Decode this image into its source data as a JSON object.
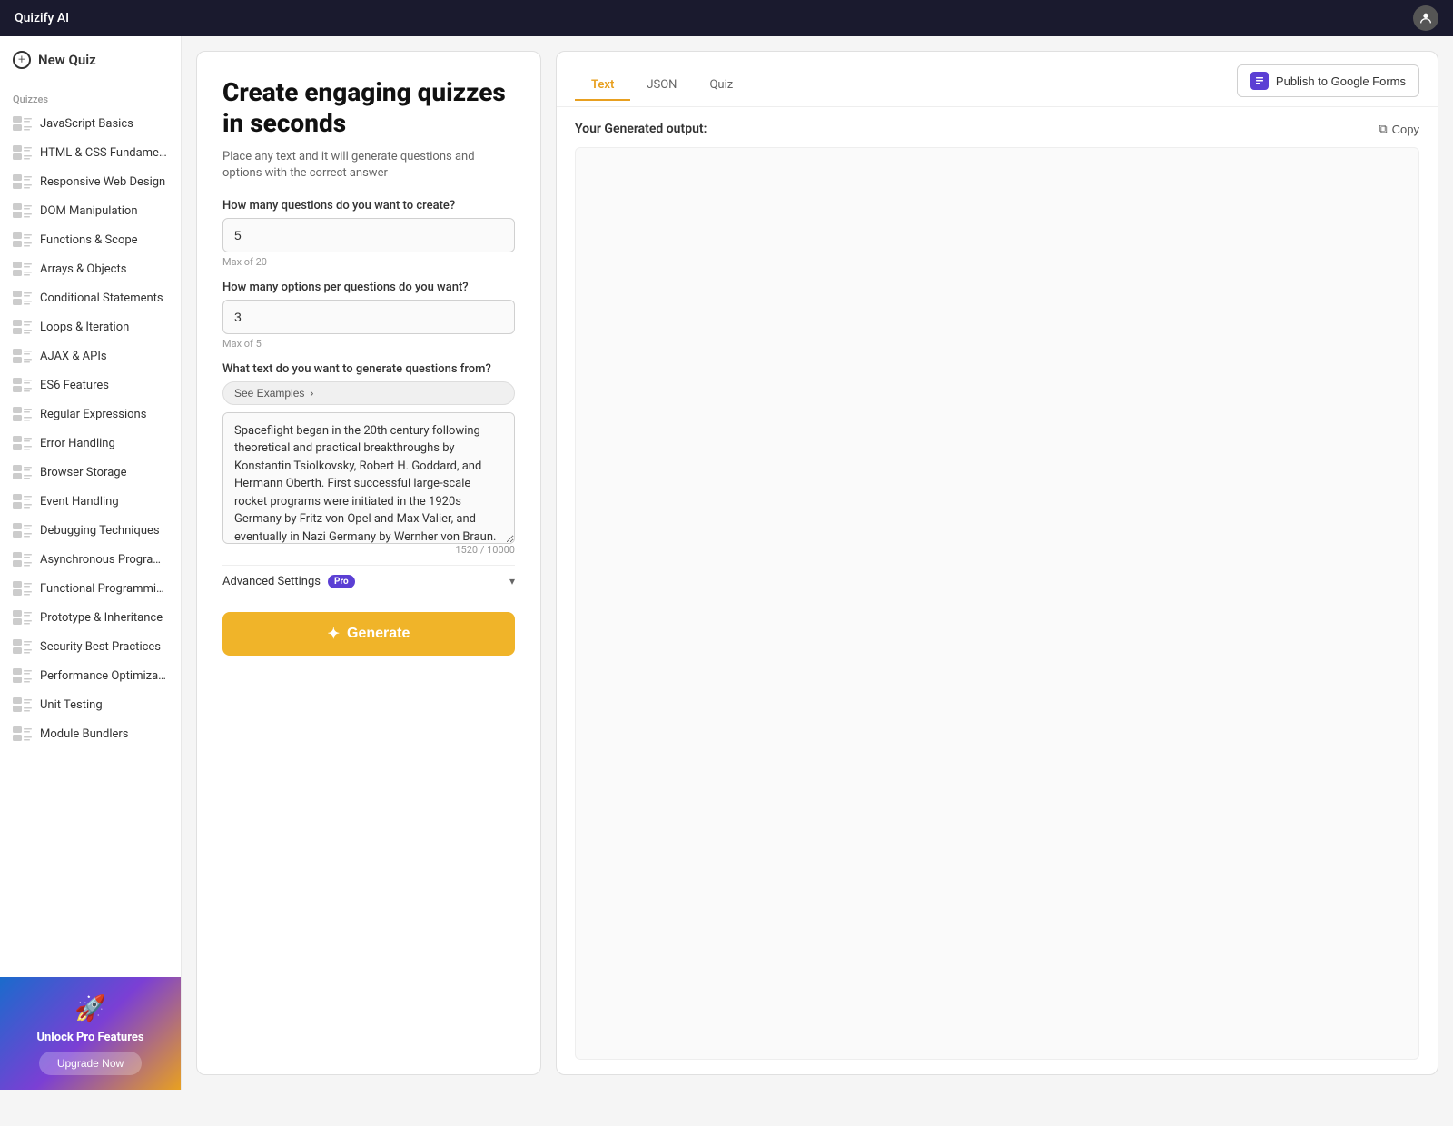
{
  "app": {
    "title": "Quizify AI",
    "avatar_icon": "👤"
  },
  "sidebar": {
    "new_quiz_label": "New Quiz",
    "section_label": "Quizzes",
    "items": [
      {
        "label": "JavaScript Basics"
      },
      {
        "label": "HTML & CSS Fundamentals"
      },
      {
        "label": "Responsive Web Design"
      },
      {
        "label": "DOM Manipulation"
      },
      {
        "label": "Functions & Scope"
      },
      {
        "label": "Arrays & Objects"
      },
      {
        "label": "Conditional Statements"
      },
      {
        "label": "Loops & Iteration"
      },
      {
        "label": "AJAX & APIs"
      },
      {
        "label": "ES6 Features"
      },
      {
        "label": "Regular Expressions"
      },
      {
        "label": "Error Handling"
      },
      {
        "label": "Browser Storage"
      },
      {
        "label": "Event Handling"
      },
      {
        "label": "Debugging Techniques"
      },
      {
        "label": "Asynchronous Programming"
      },
      {
        "label": "Functional Programming C..."
      },
      {
        "label": "Prototype & Inheritance"
      },
      {
        "label": "Security Best Practices"
      },
      {
        "label": "Performance Optimization"
      },
      {
        "label": "Unit Testing"
      },
      {
        "label": "Module Bundlers"
      }
    ],
    "upgrade": {
      "title": "Unlock Pro Features",
      "button_label": "Upgrade Now"
    }
  },
  "creator": {
    "title": "Create engaging quizzes in seconds",
    "subtitle": "Place any text and it will generate questions and options with the correct answer",
    "questions_label": "How many questions do you want to create?",
    "questions_value": "5",
    "questions_hint": "Max of 20",
    "options_label": "How many options per questions do you want?",
    "options_value": "3",
    "options_hint": "Max of 5",
    "text_label": "What text do you want to generate questions from?",
    "see_examples_label": "See Examples",
    "textarea_value": "Spaceflight began in the 20th century following theoretical and practical breakthroughs by Konstantin Tsiolkovsky, Robert H. Goddard, and Hermann Oberth. First successful large-scale rocket programs were initiated in the 1920s Germany by Fritz von Opel and Max Valier, and eventually in Nazi Germany by Wernher von Braun. The Soviet Union took the lead in the post-war Space Race, launching the first",
    "char_count": "1520 / 10000",
    "advanced_settings_label": "Advanced Settings",
    "pro_label": "Pro",
    "generate_label": "Generate"
  },
  "output": {
    "tabs": [
      {
        "label": "Text",
        "active": true
      },
      {
        "label": "JSON",
        "active": false
      },
      {
        "label": "Quiz",
        "active": false
      }
    ],
    "publish_label": "Publish to Google Forms",
    "output_label": "Your Generated output:",
    "copy_label": "Copy",
    "content": ""
  }
}
